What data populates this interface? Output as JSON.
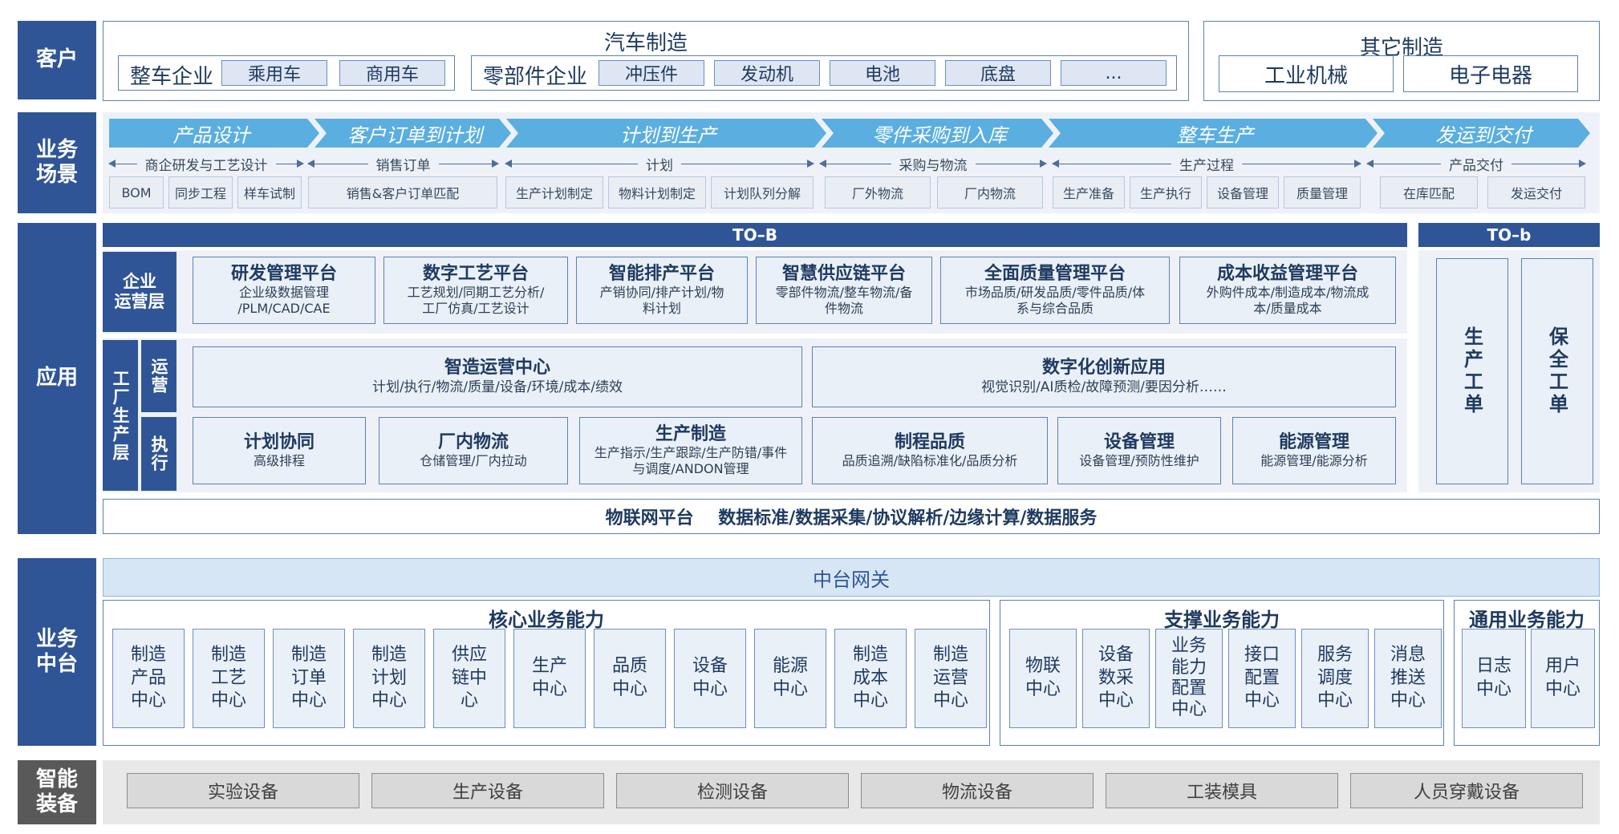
{
  "sections": {
    "customer": "客户",
    "scenario": "业务\n场景",
    "application": "应用",
    "middle": "业务\n中台",
    "equipment": "智能\n装备"
  },
  "customer": {
    "auto_title": "汽车制造",
    "vehicle_label": "整车企业",
    "vehicle_items": [
      "乘用车",
      "商用车"
    ],
    "parts_label": "零部件企业",
    "parts_items": [
      "冲压件",
      "发动机",
      "电池",
      "底盘",
      "..."
    ],
    "other_title": "其它制造",
    "other_items": [
      "工业机械",
      "电子电器"
    ]
  },
  "scenario": {
    "stages": [
      "产品设计",
      "客户订单到计划",
      "计划到生产",
      "零件采购到入库",
      "整车生产",
      "发运到交付"
    ],
    "sections": [
      "商企研发与工艺设计",
      "销售订单",
      "计划",
      "采购与物流",
      "生产过程",
      "产品交付"
    ],
    "items": [
      "BOM",
      "同步工程",
      "样车试制",
      "销售&客户订单匹配",
      "生产计划制定",
      "物料计划制定",
      "计划队列分解",
      "厂外物流",
      "厂内物流",
      "生产准备",
      "生产执行",
      "设备管理",
      "质量管理",
      "在库匹配",
      "发运交付"
    ]
  },
  "application": {
    "tob_label": "TO–B",
    "tob_small_label": "TO–b",
    "enterprise_layer": "企业\n运营层",
    "factory_layer": "工厂生产层",
    "ops_label": "运营",
    "exec_label": "执行",
    "platforms": [
      {
        "title": "研发管理平台",
        "sub": "企业级数据管理\n/PLM/CAD/CAE"
      },
      {
        "title": "数字工艺平台",
        "sub": "工艺规划/同期工艺分析/\n工厂仿真/工艺设计"
      },
      {
        "title": "智能排产平台",
        "sub": "产销协同/排产计划/物\n料计划"
      },
      {
        "title": "智慧供应链平台",
        "sub": "零部件物流/整车物流/备\n件物流"
      },
      {
        "title": "全面质量管理平台",
        "sub": "市场品质/研发品质/零件品质/体\n系与综合品质"
      },
      {
        "title": "成本收益管理平台",
        "sub": "外购件成本/制造成本/物流成\n本/质量成本"
      }
    ],
    "ops_boxes": [
      {
        "title": "智造运营中心",
        "sub": "计划/执行/物流/质量/设备/环境/成本/绩效"
      },
      {
        "title": "数字化创新应用",
        "sub": "视觉识别/AI质检/故障预测/要因分析……"
      }
    ],
    "exec_boxes": [
      {
        "title": "计划协同",
        "sub": "高级排程"
      },
      {
        "title": "厂内物流",
        "sub": "仓储管理/厂内拉动"
      },
      {
        "title": "生产制造",
        "sub": "生产指示/生产跟踪/生产防错/事件\n与调度/ANDON管理"
      },
      {
        "title": "制程品质",
        "sub": "品质追溯/缺陷标准化/品质分析"
      },
      {
        "title": "设备管理",
        "sub": "设备管理/预防性维护"
      },
      {
        "title": "能源管理",
        "sub": "能源管理/能源分析"
      }
    ],
    "small_orders": [
      "生产工单",
      "保全工单"
    ],
    "iot": "物联网平台    数据标准/数据采集/协议解析/边缘计算/数据服务"
  },
  "middle": {
    "gateway": "中台网关",
    "core_title": "核心业务能力",
    "core": [
      "制造\n产品\n中心",
      "制造\n工艺\n中心",
      "制造\n订单\n中心",
      "制造\n计划\n中心",
      "供应\n链中\n心",
      "生产\n中心",
      "品质\n中心",
      "设备\n中心",
      "能源\n中心",
      "制造\n成本\n中心",
      "制造\n运营\n中心"
    ],
    "support_title": "支撑业务能力",
    "support": [
      "物联\n中心",
      "设备\n数采\n中心",
      "业务\n能力\n配置\n中心",
      "接口\n配置\n中心",
      "服务\n调度\n中心",
      "消息\n推送\n中心"
    ],
    "general_title": "通用业务能力",
    "general": [
      "日志\n中心",
      "用户\n中心"
    ]
  },
  "equipment": {
    "items": [
      "实验设备",
      "生产设备",
      "检测设备",
      "物流设备",
      "工装模具",
      "人员穿戴设备"
    ]
  },
  "colors": {
    "primary": "#2f5597",
    "accent": "#5aaee0",
    "light": "#eaf0f8",
    "gray": "#595959"
  }
}
